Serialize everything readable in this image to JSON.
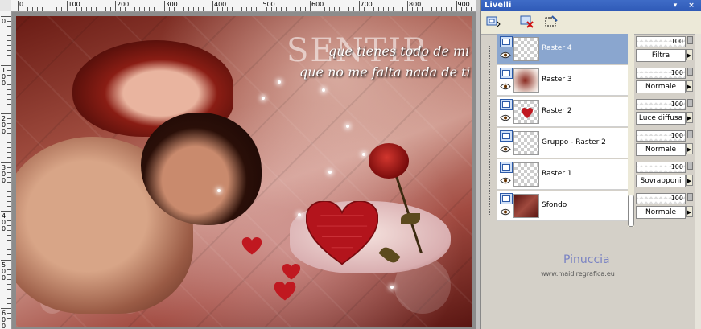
{
  "palette": {
    "title": "Livelli",
    "pin_label": "▾",
    "close_label": "×"
  },
  "ruler": {
    "top_labels": [
      "0",
      "100",
      "200",
      "300",
      "400",
      "500",
      "600",
      "700",
      "800",
      "900"
    ],
    "left_labels": [
      "0",
      "100",
      "200",
      "300",
      "400",
      "500",
      "600"
    ]
  },
  "artwork": {
    "title": "SENTIR",
    "line1": "que tienes todo de mi",
    "line2": "que no me falta nada de ti"
  },
  "layers": [
    {
      "name": "Raster 4",
      "opacity": "100",
      "blend": "Filtra",
      "selected": true
    },
    {
      "name": "Raster 3",
      "opacity": "100",
      "blend": "Normale",
      "selected": false
    },
    {
      "name": "Raster 2",
      "opacity": "100",
      "blend": "Luce diffusa",
      "selected": false
    },
    {
      "name": "Gruppo - Raster 2",
      "opacity": "100",
      "blend": "Normale",
      "selected": false
    },
    {
      "name": "Raster 1",
      "opacity": "100",
      "blend": "Sovrapponi",
      "selected": false
    },
    {
      "name": "Sfondo",
      "opacity": "100",
      "blend": "Normale",
      "selected": false
    }
  ],
  "watermark": {
    "name": "Pinuccia",
    "url": "www.maidiregrafica.eu"
  },
  "colors": {
    "title_bar": "#2f5ab7",
    "selected_layer": "#8aa6cf"
  }
}
